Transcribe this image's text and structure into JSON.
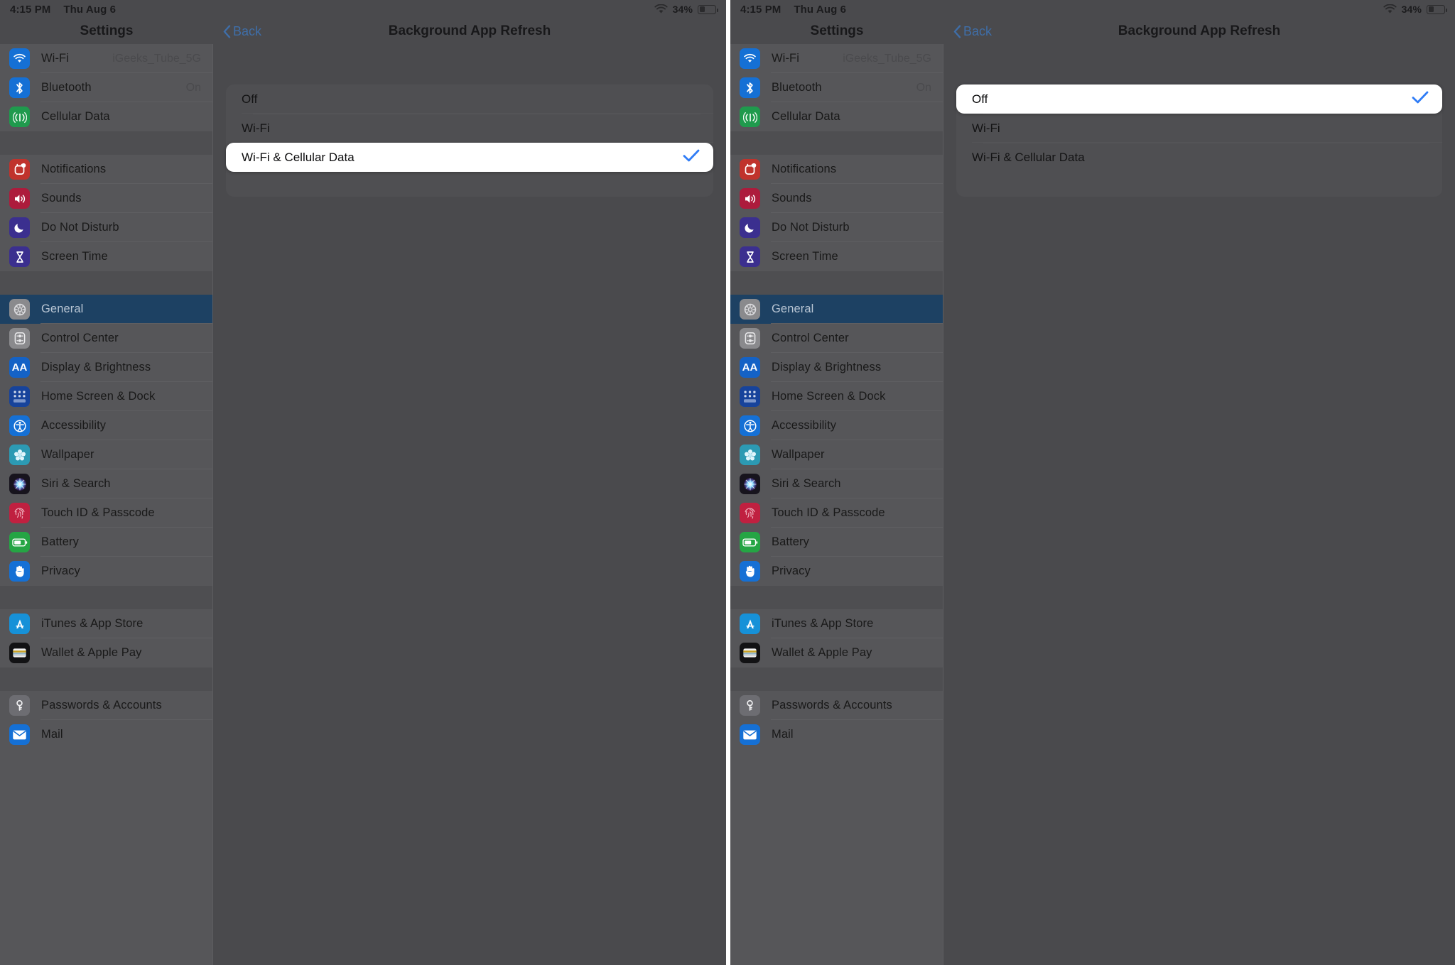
{
  "status_bar": {
    "time": "4:15 PM",
    "date": "Thu Aug 6",
    "battery_percent": "34%",
    "wifi_icon": "wifi-icon",
    "battery_icon": "battery-icon",
    "battery_level": 0.34
  },
  "sidebar": {
    "title": "Settings",
    "selected": "General",
    "groups": [
      {
        "items": [
          {
            "label": "Wi-Fi",
            "value": "iGeeks_Tube_5G",
            "icon": "wifi-icon",
            "icon_class": "ic-wifi"
          },
          {
            "label": "Bluetooth",
            "value": "On",
            "icon": "bluetooth-icon",
            "icon_class": "ic-bt"
          },
          {
            "label": "Cellular Data",
            "value": "",
            "icon": "cellular-icon",
            "icon_class": "ic-cell"
          }
        ]
      },
      {
        "items": [
          {
            "label": "Notifications",
            "value": "",
            "icon": "notifications-icon",
            "icon_class": "ic-notif"
          },
          {
            "label": "Sounds",
            "value": "",
            "icon": "speaker-icon",
            "icon_class": "ic-sounds"
          },
          {
            "label": "Do Not Disturb",
            "value": "",
            "icon": "moon-icon",
            "icon_class": "ic-dnd"
          },
          {
            "label": "Screen Time",
            "value": "",
            "icon": "hourglass-icon",
            "icon_class": "ic-screen"
          }
        ]
      },
      {
        "items": [
          {
            "label": "General",
            "value": "",
            "icon": "gear-icon",
            "icon_class": "ic-general"
          },
          {
            "label": "Control Center",
            "value": "",
            "icon": "sliders-icon",
            "icon_class": "ic-control"
          },
          {
            "label": "Display & Brightness",
            "value": "",
            "icon": "text-size-icon",
            "icon_class": "ic-display"
          },
          {
            "label": "Home Screen & Dock",
            "value": "",
            "icon": "app-grid-icon",
            "icon_class": "ic-home"
          },
          {
            "label": "Accessibility",
            "value": "",
            "icon": "accessibility-icon",
            "icon_class": "ic-access"
          },
          {
            "label": "Wallpaper",
            "value": "",
            "icon": "flower-icon",
            "icon_class": "ic-wall"
          },
          {
            "label": "Siri & Search",
            "value": "",
            "icon": "siri-icon",
            "icon_class": "ic-siri"
          },
          {
            "label": "Touch ID & Passcode",
            "value": "",
            "icon": "fingerprint-icon",
            "icon_class": "ic-touch"
          },
          {
            "label": "Battery",
            "value": "",
            "icon": "battery-icon",
            "icon_class": "ic-batt"
          },
          {
            "label": "Privacy",
            "value": "",
            "icon": "hand-icon",
            "icon_class": "ic-priv"
          }
        ]
      },
      {
        "items": [
          {
            "label": "iTunes & App Store",
            "value": "",
            "icon": "app-store-icon",
            "icon_class": "ic-itunes"
          },
          {
            "label": "Wallet & Apple Pay",
            "value": "",
            "icon": "wallet-icon",
            "icon_class": "ic-wallet"
          }
        ]
      },
      {
        "items": [
          {
            "label": "Passwords & Accounts",
            "value": "",
            "icon": "key-icon",
            "icon_class": "ic-pass"
          },
          {
            "label": "Mail",
            "value": "",
            "icon": "envelope-icon",
            "icon_class": "ic-mail"
          }
        ]
      }
    ]
  },
  "detail": {
    "back_label": "Back",
    "title": "Background App Refresh"
  },
  "picker_left": {
    "options": [
      {
        "label": "Off",
        "selected": false
      },
      {
        "label": "Wi-Fi",
        "selected": false
      },
      {
        "label": "Wi-Fi & Cellular Data",
        "selected": true
      }
    ]
  },
  "picker_right": {
    "options": [
      {
        "label": "Off",
        "selected": true
      },
      {
        "label": "Wi-Fi",
        "selected": false
      },
      {
        "label": "Wi-Fi & Cellular Data",
        "selected": false
      }
    ]
  },
  "colors": {
    "accent_blue": "#2f7cf6",
    "back_blue": "#3f6ea8",
    "selected_row": "#1d4163",
    "sidebar_bg": "#565659",
    "detail_bg": "#4a4a4d",
    "card_white": "#ffffff"
  }
}
